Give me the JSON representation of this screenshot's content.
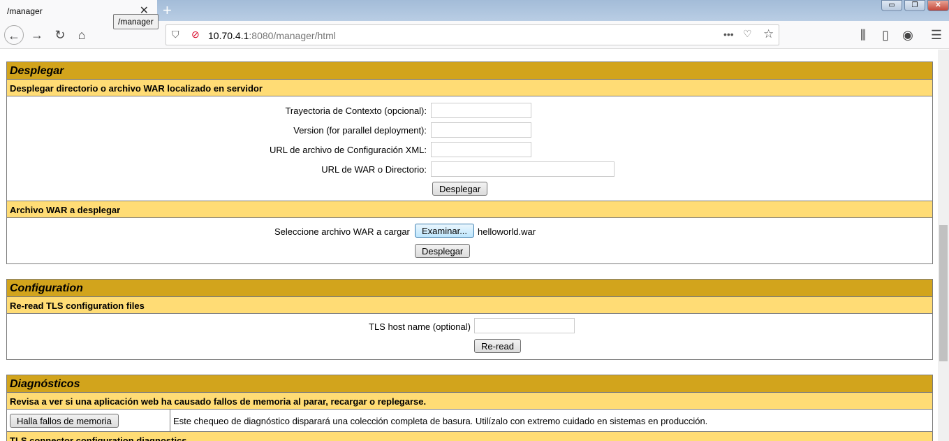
{
  "browser": {
    "tab_title": "/manager",
    "tooltip": "/manager",
    "url_host": "10.70.4.1",
    "url_rest": ":8080/manager/html"
  },
  "deploy": {
    "title": "Desplegar",
    "server_sub": "Desplegar directorio o archivo WAR localizado en servidor",
    "fields": [
      {
        "label": "Trayectoria de Contexto (opcional):",
        "value": ""
      },
      {
        "label": "Version (for parallel deployment):",
        "value": ""
      },
      {
        "label": "URL de archivo de Configuración XML:",
        "value": ""
      },
      {
        "label": "URL de WAR o Directorio:",
        "value": ""
      }
    ],
    "deploy_button": "Desplegar",
    "war_sub": "Archivo WAR a desplegar",
    "war_label": "Seleccione archivo WAR a cargar",
    "browse_button": "Examinar...",
    "file_name": "helloworld.war",
    "war_deploy_button": "Desplegar"
  },
  "config": {
    "title": "Configuration",
    "sub": "Re-read TLS configuration files",
    "host_label": "TLS host name (optional)",
    "host_value": "",
    "reread_button": "Re-read"
  },
  "diag": {
    "title": "Diagnósticos",
    "sub": "Revisa a ver si una aplicación web ha causado fallos de memoria al parar, recargar o replegarse.",
    "leak_button": "Halla fallos de memoria",
    "leak_desc": "Este chequeo de diagnóstico disparará una colección completa de basura. Utilízalo con extremo cuidado en sistemas en producción.",
    "tls_sub": "TLS connector configuration diagnostics"
  }
}
